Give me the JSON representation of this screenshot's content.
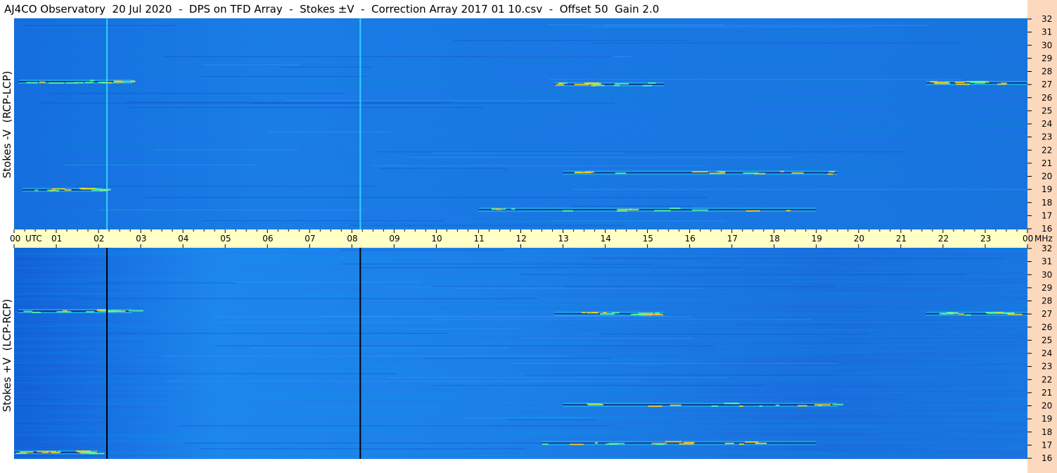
{
  "title": "AJ4CO Observatory  20 Jul 2020  -  DPS on TFD Array  -  Stokes ±V  -  Correction Array 2017 01 10.csv  -  Offset 50  Gain 2.0",
  "colors": {
    "time_band": "#ffffc6",
    "freq_band": "#fcd9bd",
    "background_top": "#1a74e6",
    "background_bottom": "#1e6fe2",
    "burst_warm": "#ffd21a",
    "burst_cyan": "#2ef0ff",
    "dark_line": "#06186a"
  },
  "chart_data": [
    {
      "type": "heatmap",
      "panel": "top",
      "ylabel": "Stokes -V  (RCP-LCP)",
      "y_unit": "MHz",
      "y_ticks": [
        "32",
        "31",
        "30",
        "29",
        "28",
        "27",
        "26",
        "25",
        "24",
        "23",
        "22",
        "21",
        "20",
        "19",
        "18",
        "17",
        "16"
      ],
      "ylim": [
        16,
        32
      ],
      "x_range_utc_hours": [
        0,
        24
      ],
      "grid": false,
      "features": {
        "vertical_lines_utc": [
          2.2,
          8.2
        ],
        "vertical_line_color": "#37e0ff",
        "burst_streaks": [
          {
            "utc": [
              0.1,
              2.8
            ],
            "mhz": 27.2
          },
          {
            "utc": [
              12.8,
              15.4
            ],
            "mhz": 27.0
          },
          {
            "utc": [
              21.6,
              24.0
            ],
            "mhz": 27.1
          },
          {
            "utc": [
              11.0,
              19.0
            ],
            "mhz": 17.5
          },
          {
            "utc": [
              0.2,
              2.1
            ],
            "mhz": 19.0
          },
          {
            "utc": [
              13.0,
              19.5
            ],
            "mhz": 20.3
          }
        ]
      }
    },
    {
      "type": "heatmap",
      "panel": "bottom",
      "ylabel": "Stokes +V  (LCP-RCP)",
      "y_unit": "MHz",
      "y_ticks": [
        "32",
        "31",
        "30",
        "29",
        "28",
        "27",
        "26",
        "25",
        "24",
        "23",
        "22",
        "21",
        "20",
        "19",
        "18",
        "17",
        "16"
      ],
      "ylim": [
        16,
        32
      ],
      "x_range_utc_hours": [
        0,
        24
      ],
      "grid": false,
      "features": {
        "vertical_lines_utc": [
          2.2,
          8.2
        ],
        "vertical_line_color": "#000000",
        "burst_streaks": [
          {
            "utc": [
              0.1,
              2.8
            ],
            "mhz": 27.2
          },
          {
            "utc": [
              12.8,
              15.4
            ],
            "mhz": 27.0
          },
          {
            "utc": [
              21.6,
              24.0
            ],
            "mhz": 27.0
          },
          {
            "utc": [
              12.5,
              19.0
            ],
            "mhz": 17.2
          },
          {
            "utc": [
              0.0,
              2.0
            ],
            "mhz": 16.5
          },
          {
            "utc": [
              13.0,
              19.5
            ],
            "mhz": 20.1
          }
        ]
      }
    }
  ],
  "time_axis": {
    "unit_label": "UTC",
    "end_label": "MHz",
    "labels": [
      "00",
      "01",
      "02",
      "03",
      "04",
      "05",
      "06",
      "07",
      "08",
      "09",
      "10",
      "11",
      "12",
      "13",
      "14",
      "15",
      "16",
      "17",
      "18",
      "19",
      "20",
      "21",
      "22",
      "23",
      "00"
    ]
  }
}
